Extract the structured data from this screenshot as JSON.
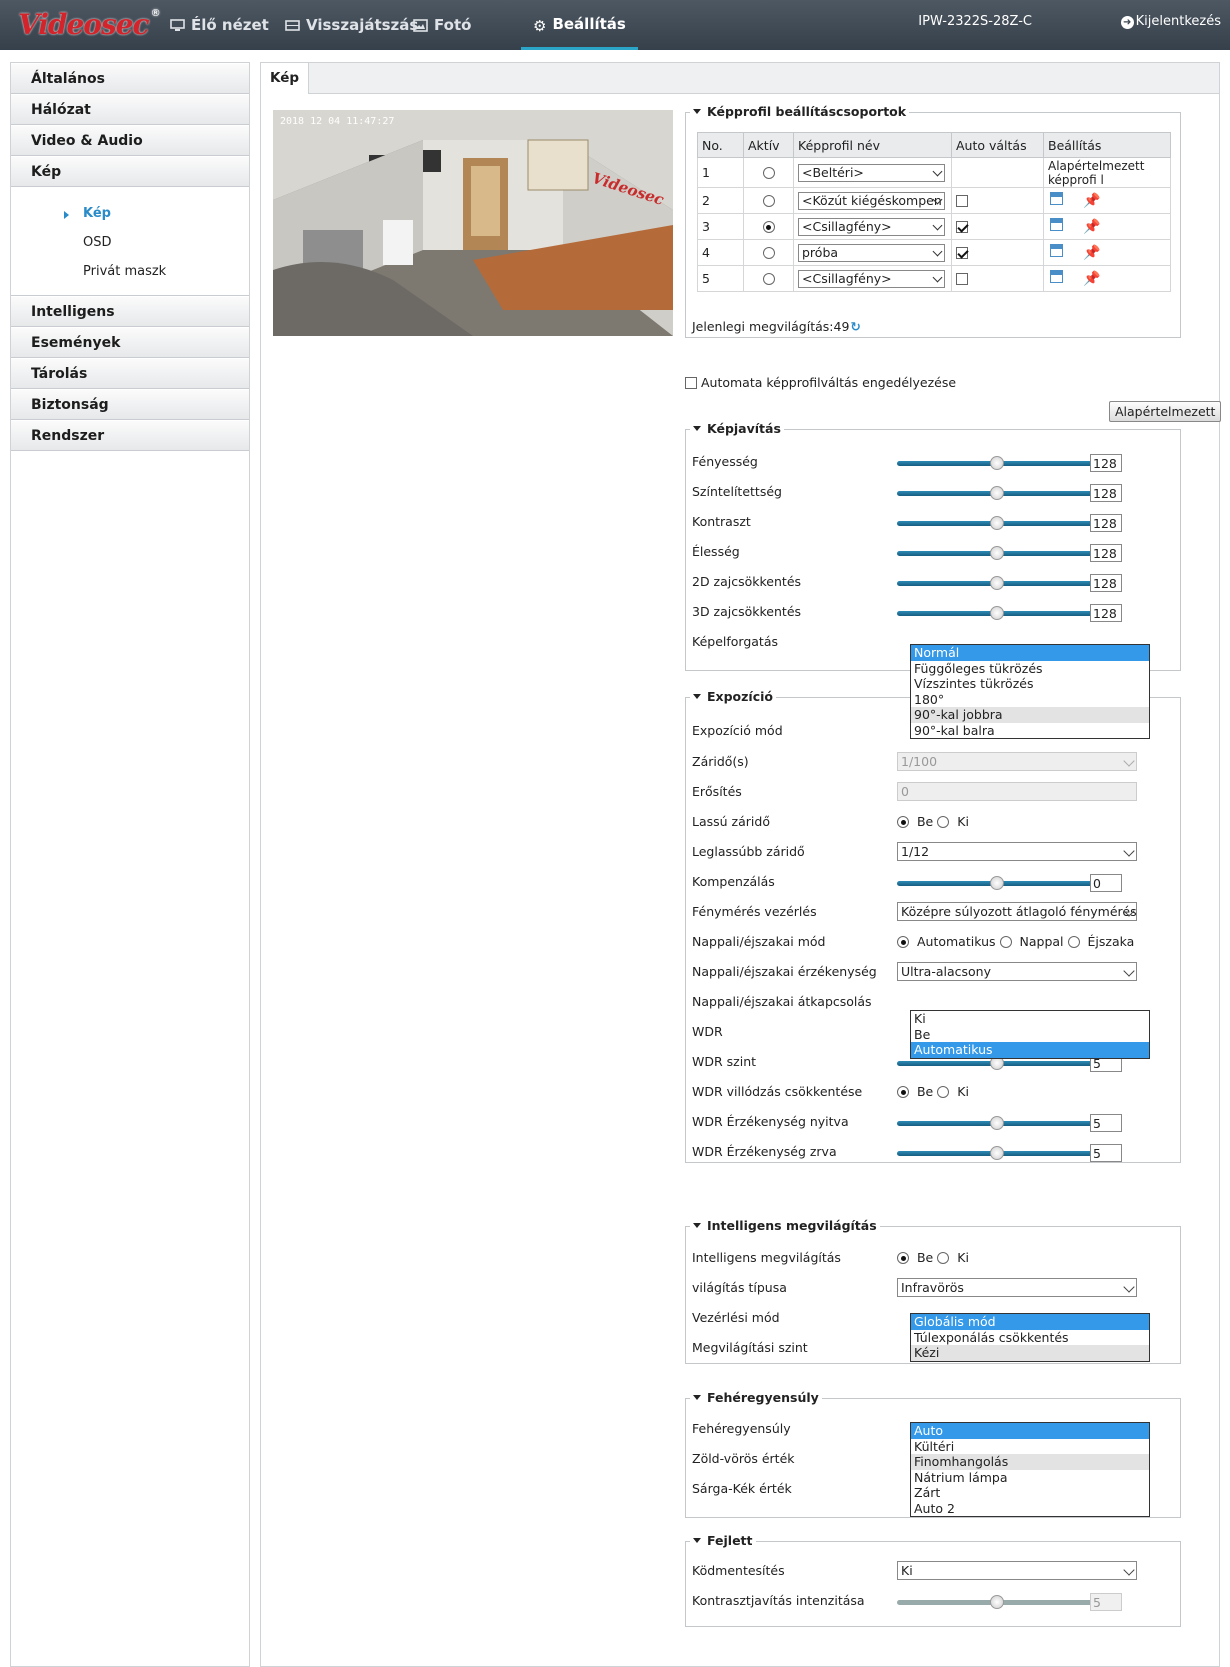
{
  "header": {
    "logo": "Videosec",
    "logo_mark": "®",
    "nav": [
      {
        "label": "Élő nézet",
        "icon": "monitor-icon"
      },
      {
        "label": "Visszajátszás",
        "icon": "film-icon"
      },
      {
        "label": "Fotó",
        "icon": "photo-icon"
      },
      {
        "label": "Beállítás",
        "icon": "gear-icon",
        "active": true
      }
    ],
    "model": "IPW-2322S-28Z-C",
    "logout": "Kijelentkezés"
  },
  "sidebar": {
    "items": [
      "Általános",
      "Hálózat",
      "Video & Audio",
      "Kép"
    ],
    "subitems": [
      "Kép",
      "OSD",
      "Privát maszk"
    ],
    "items2": [
      "Intelligens",
      "Események",
      "Tárolás",
      "Biztonság",
      "Rendszer"
    ]
  },
  "tab": "Kép",
  "video": {
    "timestamp": "2018 12 04 11:47:27",
    "watermark": "Videosec"
  },
  "profiles": {
    "legend": "Képprofil beállításcsoportok",
    "headers": [
      "No.",
      "Aktív",
      "Képprofil név",
      "Auto váltás",
      "Beállítás"
    ],
    "rows": [
      {
        "no": "1",
        "name": "<Beltéri>",
        "setting": "Alapértelmezett képprofi l"
      },
      {
        "no": "2",
        "name": "<Közút kiégéskompen"
      },
      {
        "no": "3",
        "name": "<Csillagfény>"
      },
      {
        "no": "4",
        "name": "próba"
      },
      {
        "no": "5",
        "name": "<Csillagfény>"
      }
    ],
    "current": "Jelenlegi megvilágítás:49"
  },
  "auto_switch": "Automata képprofilváltás engedélyezése",
  "default_btn": "Alapértelmezett",
  "kepjavitas": {
    "legend": "Képjavítás",
    "rows": [
      {
        "label": "Fényesség",
        "value": "128"
      },
      {
        "label": "Színtelítettség",
        "value": "128"
      },
      {
        "label": "Kontraszt",
        "value": "128"
      },
      {
        "label": "Élesség",
        "value": "128"
      },
      {
        "label": "2D zajcsökkentés",
        "value": "128"
      },
      {
        "label": "3D zajcsökkentés",
        "value": "128"
      }
    ],
    "rotate_label": "Képelforgatás",
    "rotate_options": [
      "Normál",
      "Függőleges tükrözés",
      "Vízszintes tükrözés",
      "180°",
      "90°-kal jobbra",
      "90°-kal balra"
    ]
  },
  "expozicio": {
    "legend": "Expozíció",
    "mode": "Expozíció mód",
    "shutter": "Záridő(s)",
    "shutter_val": "1/100",
    "gain": "Erősítés",
    "gain_val": "0",
    "slow": "Lassú záridő",
    "be": "Be",
    "ki": "Ki",
    "slowest": "Leglassúbb záridő",
    "slowest_val": "1/12",
    "comp": "Kompenzálás",
    "comp_val": "0",
    "metering": "Fénymérés vezérlés",
    "metering_val": "Középre súlyozott átlagoló fénymérés",
    "daynight": "Nappali/éjszakai mód",
    "auto": "Automatikus",
    "day": "Nappal",
    "night": "Éjszaka",
    "sens": "Nappali/éjszakai érzékenység",
    "sens_val": "Ultra-alacsony",
    "switch": "Nappali/éjszakai átkapcsolás",
    "switch_options": [
      "Ki",
      "Be",
      "Automatikus"
    ],
    "wdr": "WDR",
    "wdr_level": "WDR szint",
    "wdr_level_val": "5",
    "flicker": "WDR villódzás csökkentése",
    "on_sens": "WDR Érzékenység nyitva",
    "on_val": "5",
    "off_sens": "WDR Érzékenység zrva",
    "off_val": "5"
  },
  "intelligens": {
    "legend": "Intelligens megvilágítás",
    "il": "Intelligens megvilágítás",
    "type": "világítás típusa",
    "type_val": "Infravörös",
    "ctrl": "Vezérlési mód",
    "ctrl_options": [
      "Globális mód",
      "Túlexponálás csökkentés",
      "Kézi"
    ],
    "level": "Megvilágítási szint"
  },
  "feher": {
    "legend": "Fehéregyensúly",
    "wb": "Fehéregyensúly",
    "wb_options": [
      "Auto",
      "Kültéri",
      "Finomhangolás",
      "Nátrium lámpa",
      "Zárt",
      "Auto 2"
    ],
    "gr": "Zöld-vörös érték",
    "by": "Sárga-Kék érték"
  },
  "fejlett": {
    "legend": "Fejlett",
    "defog": "Ködmentesítés",
    "defog_val": "Ki",
    "contrast": "Kontrasztjavítás intenzitása",
    "contrast_val": "5"
  }
}
